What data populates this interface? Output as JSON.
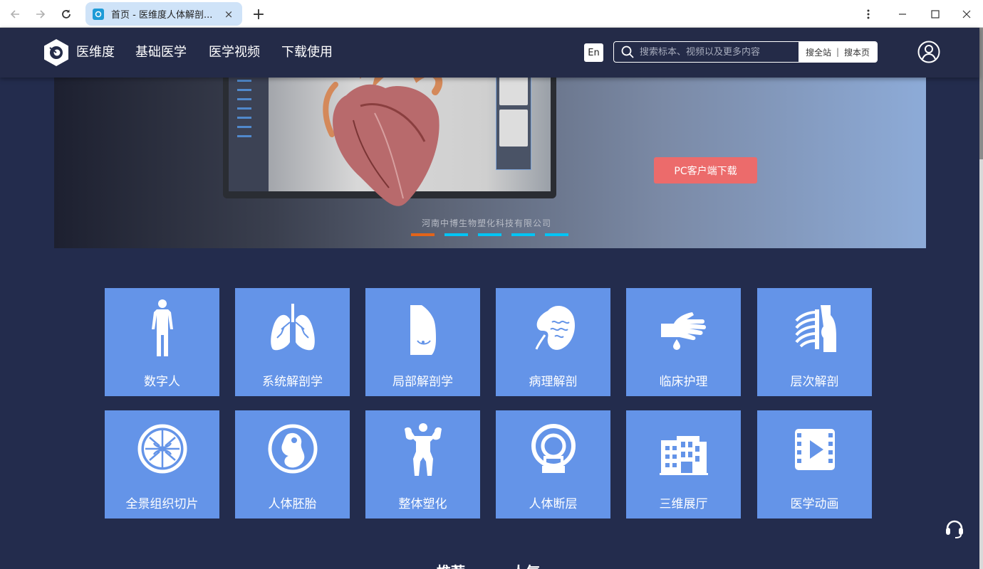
{
  "browser": {
    "tab_title": "首页 - 医维度人体解剖...",
    "tab_close": "×",
    "new_tab": "+"
  },
  "header": {
    "brand": "医维度",
    "menu": [
      "基础医学",
      "医学视频",
      "下载使用"
    ],
    "lang": "En",
    "search": {
      "placeholder": "搜索标本、视频以及更多内容",
      "scope_all": "搜全站",
      "separator": "|",
      "scope_page": "搜本页"
    }
  },
  "banner": {
    "download_button": "PC客户端下载",
    "watermark": "河南中博生物塑化科技有限公司",
    "slides": 5,
    "active_slide": 1
  },
  "tiles": [
    {
      "label": "数字人",
      "icon": "human-body-icon"
    },
    {
      "label": "系统解剖学",
      "icon": "lungs-icon"
    },
    {
      "label": "局部解剖学",
      "icon": "torso-icon"
    },
    {
      "label": "病理解剖",
      "icon": "kidney-icon"
    },
    {
      "label": "临床护理",
      "icon": "hand-drop-icon"
    },
    {
      "label": "层次解剖",
      "icon": "ribcage-icon"
    },
    {
      "label": "全景组织切片",
      "icon": "tissue-slice-icon"
    },
    {
      "label": "人体胚胎",
      "icon": "embryo-icon"
    },
    {
      "label": "整体塑化",
      "icon": "muscle-man-icon"
    },
    {
      "label": "人体断层",
      "icon": "ct-scanner-icon"
    },
    {
      "label": "三维展厅",
      "icon": "building-icon"
    },
    {
      "label": "医学动画",
      "icon": "video-film-icon"
    }
  ],
  "bottom_tabs": [
    "推荐",
    "人气"
  ],
  "colors": {
    "page_bg": "#232c4d",
    "header_bg": "#242b48",
    "tile_bg": "#6494e8",
    "download_btn": "#ec6b6b",
    "dot_active": "#e2641a",
    "dot_inactive": "#00c4f5"
  }
}
